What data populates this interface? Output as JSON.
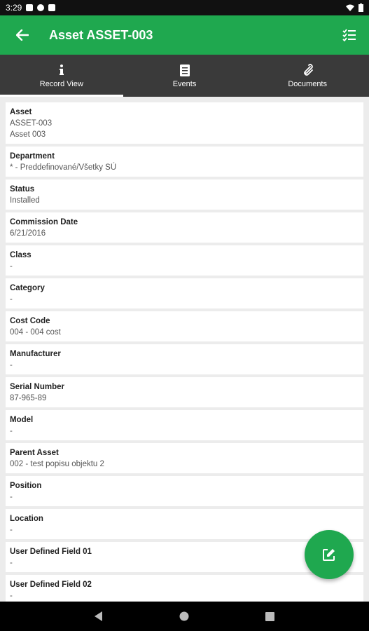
{
  "status_bar": {
    "time": "3:29"
  },
  "app_bar": {
    "title": "Asset ASSET-003"
  },
  "tabs": [
    {
      "label": "Record View",
      "icon": "info-icon"
    },
    {
      "label": "Events",
      "icon": "document-icon"
    },
    {
      "label": "Documents",
      "icon": "paperclip-icon"
    }
  ],
  "fields": [
    {
      "label": "Asset",
      "values": [
        "ASSET-003",
        "Asset 003"
      ]
    },
    {
      "label": "Department",
      "values": [
        "* - Preddefinované/Všetky SÚ"
      ]
    },
    {
      "label": "Status",
      "values": [
        "Installed"
      ]
    },
    {
      "label": "Commission Date",
      "values": [
        "6/21/2016"
      ]
    },
    {
      "label": "Class",
      "values": [
        "-"
      ]
    },
    {
      "label": "Category",
      "values": [
        "-"
      ]
    },
    {
      "label": "Cost Code",
      "values": [
        "004 - 004 cost"
      ]
    },
    {
      "label": "Manufacturer",
      "values": [
        "-"
      ]
    },
    {
      "label": "Serial Number",
      "values": [
        "87-965-89"
      ]
    },
    {
      "label": "Model",
      "values": [
        "-"
      ]
    },
    {
      "label": "Parent Asset",
      "values": [
        "002 - test popisu objektu 2"
      ]
    },
    {
      "label": "Position",
      "values": [
        "-"
      ]
    },
    {
      "label": "Location",
      "values": [
        "-"
      ]
    },
    {
      "label": "User Defined Field 01",
      "values": [
        "-"
      ]
    },
    {
      "label": "User Defined Field 02",
      "values": [
        "-"
      ]
    }
  ],
  "colors": {
    "primary": "#1fa84f",
    "tab_bar": "#3a3a3a",
    "background": "#ececec"
  }
}
